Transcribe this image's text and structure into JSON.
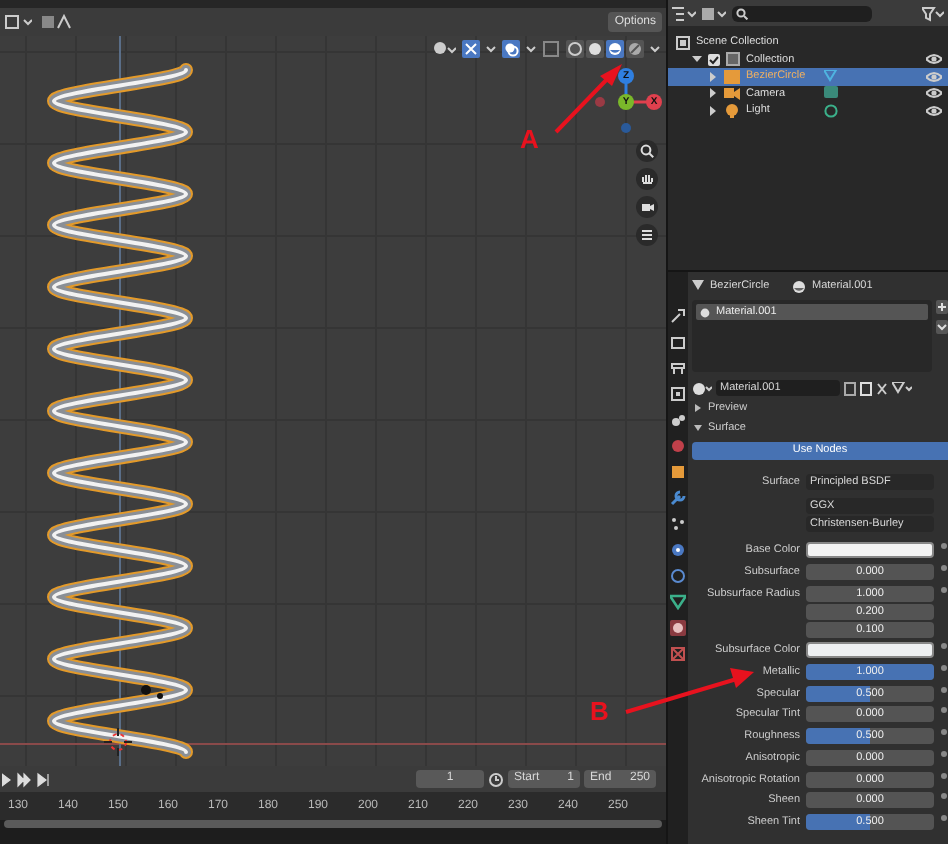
{
  "viewport": {
    "options_label": "Options",
    "shading_modes": [
      {
        "selected": false
      },
      {
        "selected": false
      },
      {
        "selected": true
      },
      {
        "selected": false
      }
    ],
    "gizmo_axes": [
      {
        "label": "Z",
        "color": "#2f7fe0"
      },
      {
        "label": "Y",
        "color": "#7ab82a"
      },
      {
        "label": "X",
        "color": "#e0404e"
      }
    ]
  },
  "annotations": [
    {
      "label": "A"
    },
    {
      "label": "B"
    }
  ],
  "outliner": {
    "root": "Scene Collection",
    "items": [
      {
        "label": "Collection",
        "checked": true,
        "expanded": true,
        "children": [
          {
            "label": "BezierCircle",
            "kind": "curve",
            "selected": true
          },
          {
            "label": "Camera",
            "kind": "camera",
            "selected": false
          },
          {
            "label": "Light",
            "kind": "light",
            "selected": false
          }
        ]
      }
    ]
  },
  "properties": {
    "object": "BezierCircle",
    "material": "Material.001",
    "slots": [
      {
        "label": "Material.001",
        "selected": true
      }
    ],
    "material_field": "Material.001",
    "sections": [
      {
        "label": "Preview",
        "expanded": false
      },
      {
        "label": "Surface",
        "expanded": true
      }
    ],
    "use_nodes": "Use Nodes",
    "surface": {
      "label": "Surface",
      "value": "Principled BSDF"
    },
    "dropdowns": [
      "GGX",
      "Christensen-Burley"
    ],
    "fields": [
      {
        "label": "Base Color",
        "kind": "color",
        "color": "#f4f4f4"
      },
      {
        "label": "Subsurface",
        "kind": "slider",
        "value": "0.000",
        "level": 0
      },
      {
        "label": "Subsurface Radius",
        "kind": "vector",
        "values": [
          "1.000",
          "0.200",
          "0.100"
        ]
      },
      {
        "label": "Subsurface Color",
        "kind": "color",
        "color": "#eef0f2"
      },
      {
        "label": "Metallic",
        "kind": "slider",
        "value": "1.000",
        "level": 1
      },
      {
        "label": "Specular",
        "kind": "slider",
        "value": "0.500",
        "level": 0.5
      },
      {
        "label": "Specular Tint",
        "kind": "slider",
        "value": "0.000",
        "level": 0
      },
      {
        "label": "Roughness",
        "kind": "slider",
        "value": "0.500",
        "level": 0.5
      },
      {
        "label": "Anisotropic",
        "kind": "slider",
        "value": "0.000",
        "level": 0
      },
      {
        "label": "Anisotropic Rotation",
        "kind": "slider",
        "value": "0.000",
        "level": 0
      },
      {
        "label": "Sheen",
        "kind": "slider",
        "value": "0.000",
        "level": 0
      },
      {
        "label": "Sheen Tint",
        "kind": "slider",
        "value": "0.500",
        "level": 0.5
      }
    ]
  },
  "timeline": {
    "current_frame": "1",
    "start_label": "Start",
    "start": "1",
    "end_label": "End",
    "end": "250",
    "ticks": [
      "130",
      "140",
      "150",
      "160",
      "170",
      "180",
      "190",
      "200",
      "210",
      "220",
      "230",
      "240",
      "250"
    ]
  }
}
